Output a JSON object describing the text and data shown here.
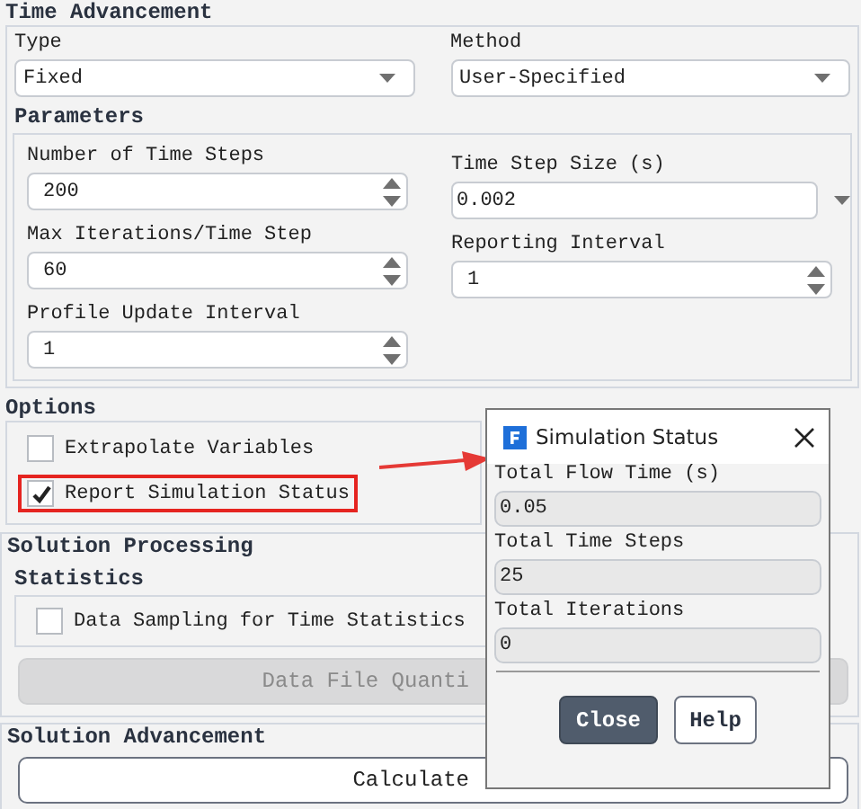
{
  "time_advancement": {
    "title": "Time Advancement",
    "type": {
      "label": "Type",
      "value": "Fixed"
    },
    "method": {
      "label": "Method",
      "value": "User-Specified"
    },
    "parameters": {
      "title": "Parameters",
      "fields": [
        {
          "label": "Number of Time Steps",
          "value": "200",
          "kind": "spinner"
        },
        {
          "label": "Time Step Size (s)",
          "value": "0.002",
          "kind": "dropdown"
        },
        {
          "label": "Max Iterations/Time Step",
          "value": "60",
          "kind": "spinner"
        },
        {
          "label": "Reporting Interval",
          "value": "1",
          "kind": "spinner"
        },
        {
          "label": "Profile Update Interval",
          "value": "1",
          "kind": "spinner"
        }
      ]
    }
  },
  "options": {
    "title": "Options",
    "items": [
      {
        "label": "Extrapolate Variables",
        "checked": false,
        "highlighted": false
      },
      {
        "label": "Report Simulation Status",
        "checked": true,
        "highlighted": true
      }
    ]
  },
  "solution_processing": {
    "title": "Solution Processing",
    "statistics": {
      "title": "Statistics",
      "items": [
        {
          "label": "Data Sampling for Time Statistics",
          "checked": false
        }
      ]
    },
    "button": {
      "label": "Data File Quanti",
      "disabled": true
    }
  },
  "solution_advancement": {
    "title": "Solution Advancement",
    "button": "Calculate"
  },
  "dialog": {
    "title": "Simulation Status",
    "fields": [
      {
        "label": "Total Flow Time (s)",
        "value": "0.05"
      },
      {
        "label": "Total Time Steps",
        "value": "25"
      },
      {
        "label": "Total Iterations",
        "value": "0"
      }
    ],
    "buttons": [
      {
        "label": "Close",
        "kind": "primary"
      },
      {
        "label": "Help",
        "kind": "secondary"
      }
    ]
  }
}
